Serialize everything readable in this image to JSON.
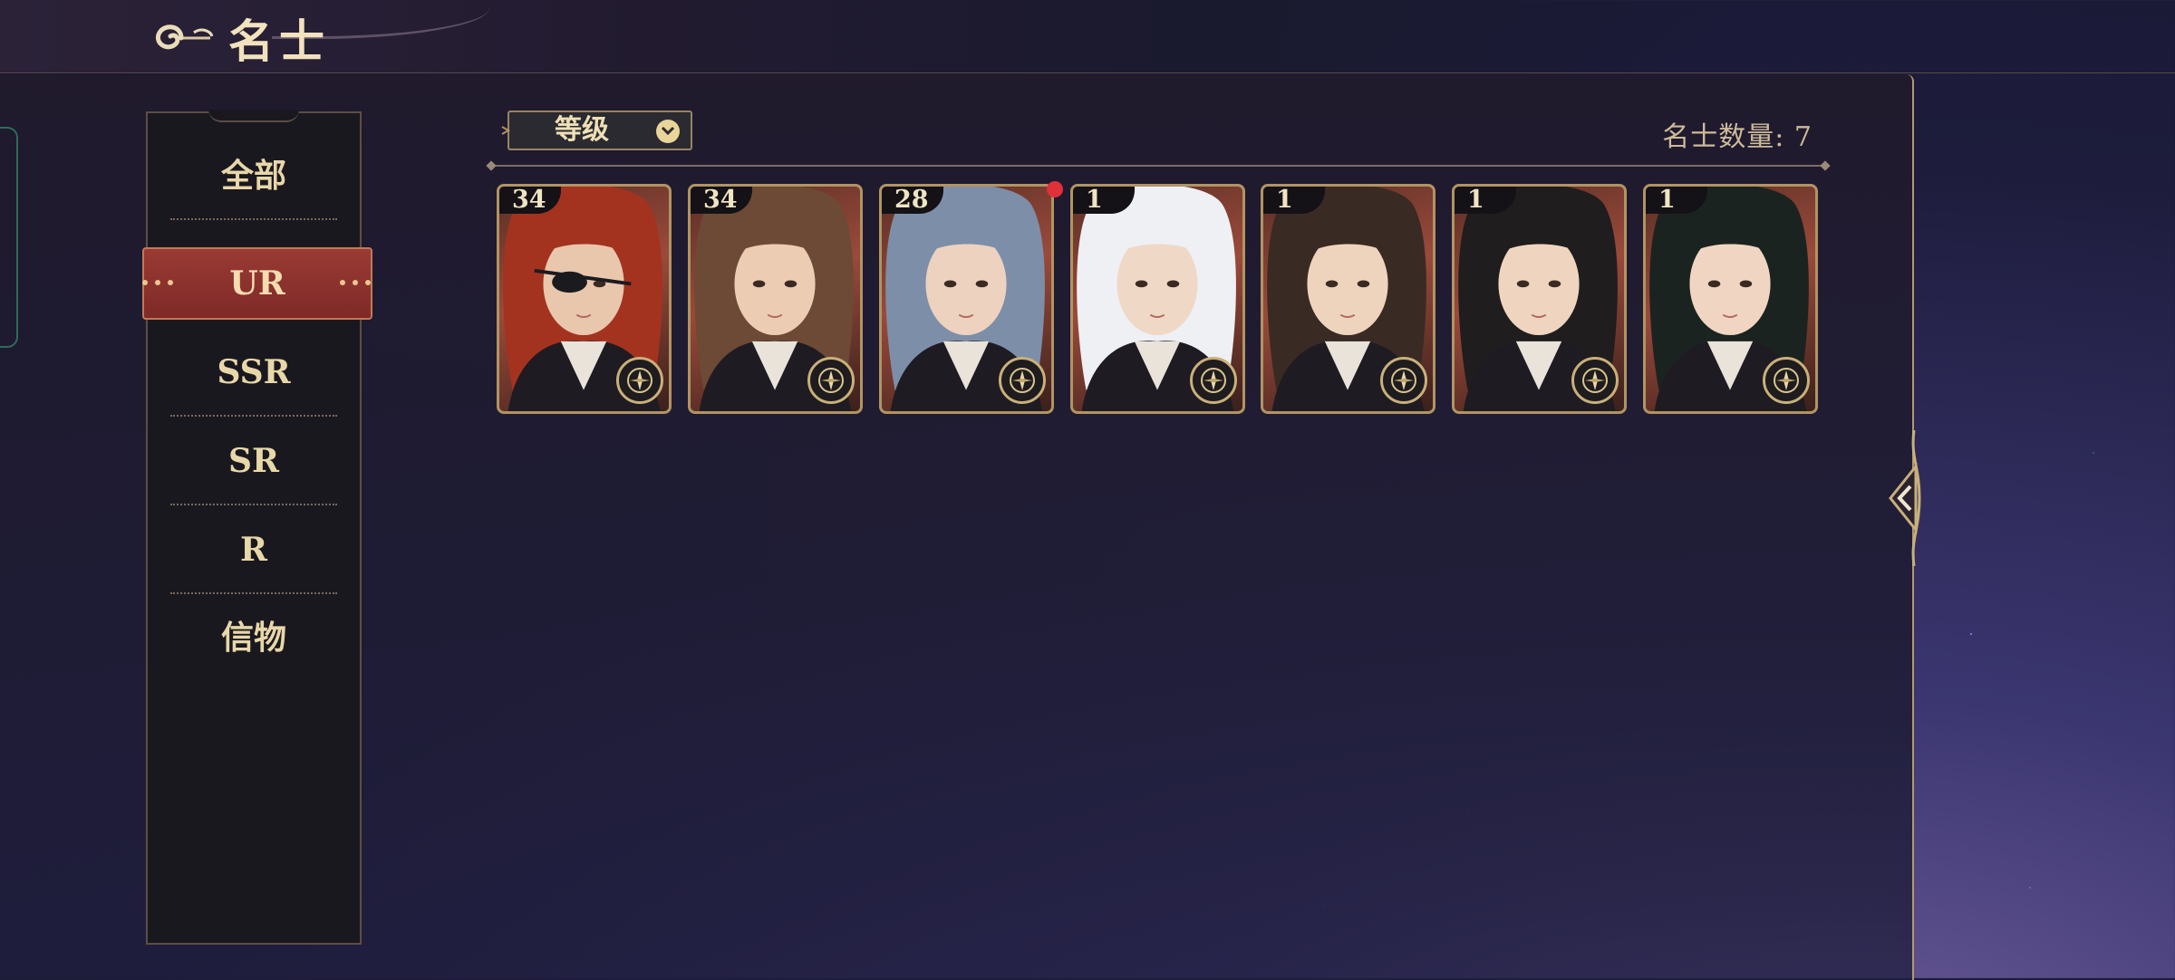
{
  "header": {
    "title": "名士"
  },
  "sidebar": {
    "items": [
      {
        "label": "全部"
      },
      {
        "label": "UR"
      },
      {
        "label": "SSR"
      },
      {
        "label": "SR"
      },
      {
        "label": "R"
      },
      {
        "label": "信物"
      }
    ],
    "active": "UR"
  },
  "toolbar": {
    "sort_label": "等级",
    "count_text": "名士数量: 7"
  },
  "cards": [
    {
      "level": "34",
      "hair": "#a3331f",
      "skin": "#e8c7ad",
      "eyepatch": true,
      "notification": false
    },
    {
      "level": "34",
      "hair": "#6d4a35",
      "skin": "#ecccb2",
      "eyepatch": false,
      "notification": false
    },
    {
      "level": "28",
      "hair": "#7d8ea8",
      "skin": "#ecd2bf",
      "eyepatch": false,
      "notification": true
    },
    {
      "level": "1",
      "hair": "#eef0f4",
      "skin": "#f0d8c6",
      "eyepatch": false,
      "notification": false
    },
    {
      "level": "1",
      "hair": "#3a2a24",
      "skin": "#efd4bd",
      "eyepatch": false,
      "notification": false
    },
    {
      "level": "1",
      "hair": "#1f1d1d",
      "skin": "#efd4c0",
      "eyepatch": false,
      "notification": false
    },
    {
      "level": "1",
      "hair": "#1b2320",
      "skin": "#f0d6c2",
      "eyepatch": false,
      "notification": false
    }
  ],
  "colors": {
    "accent": "#8e2e2c",
    "gold": "#b19462",
    "text": "#e8d7a8",
    "badge": "#e0303a"
  }
}
